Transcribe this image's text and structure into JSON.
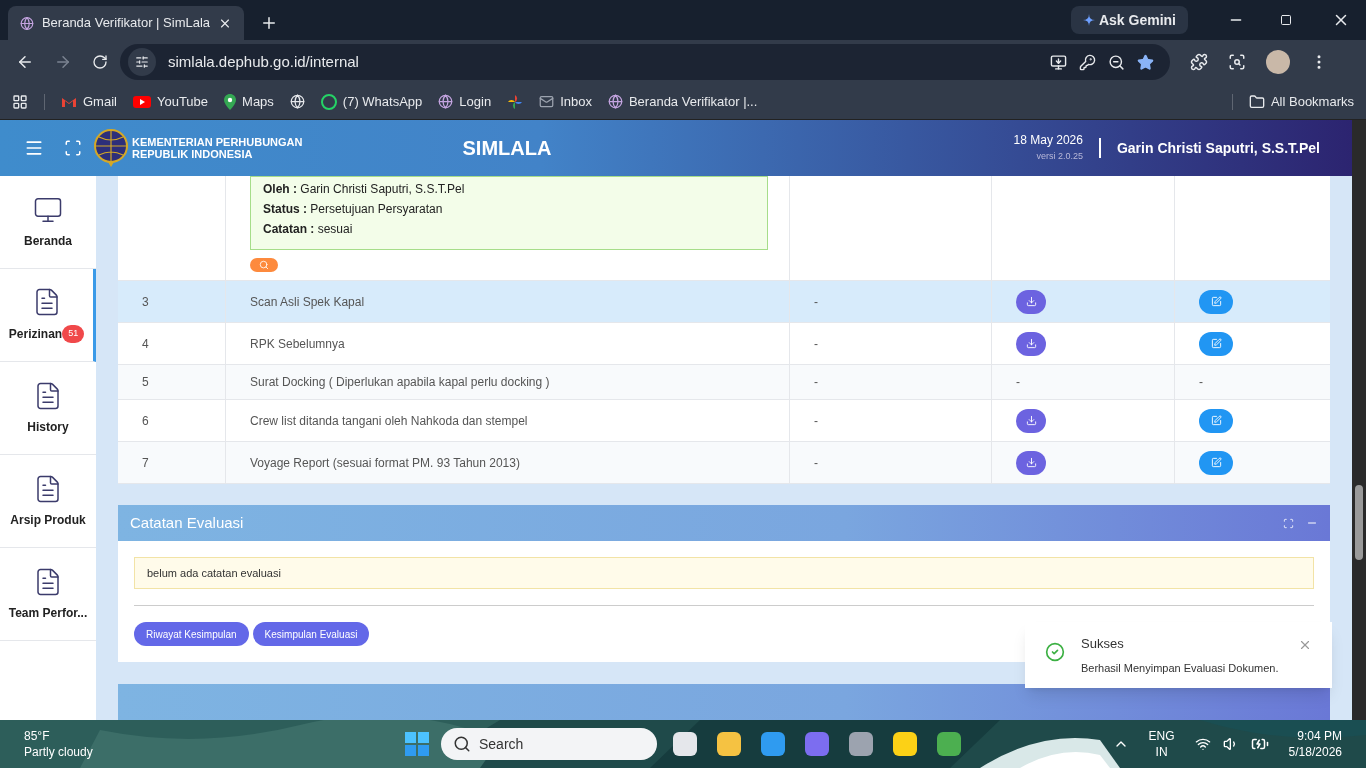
{
  "browser": {
    "tab": {
      "title": "Beranda Verifikator | SimLala"
    },
    "ask_button": "Ask Gemini",
    "address": "simlala.dephub.go.id/internal",
    "bookmarks": [
      {
        "label": "Gmail",
        "kind": "gmail"
      },
      {
        "label": "YouTube",
        "kind": "youtube"
      },
      {
        "label": "Maps",
        "kind": "maps"
      },
      {
        "kind": "globe"
      },
      {
        "label": "(7) WhatsApp",
        "kind": "whatsapp"
      },
      {
        "label": "Login",
        "kind": "site"
      },
      {
        "kind": "pinwheel"
      },
      {
        "label": "Inbox",
        "kind": "mail"
      },
      {
        "label": "Beranda Verifikator |...",
        "kind": "site"
      }
    ],
    "all_bookmarks": "All Bookmarks"
  },
  "header": {
    "org_line_1": "KEMENTERIAN PERHUBUNGAN",
    "org_line_2": "REPUBLIK INDONESIA",
    "app_title": "SIMLALA",
    "date": "18 May 2026",
    "version": "versi 2.0.25",
    "user": "Garin Christi Saputri, S.S.T.Pel"
  },
  "sidebar": {
    "items": [
      {
        "label": "Beranda",
        "kind": "home",
        "selected": false
      },
      {
        "label": "Perizinan",
        "kind": "page",
        "selected": true,
        "badge": "51"
      },
      {
        "label": "History",
        "kind": "page",
        "selected": false
      },
      {
        "label": "Arsip Produk",
        "kind": "page",
        "selected": false
      },
      {
        "label": "Team Perfor...",
        "kind": "page",
        "selected": false
      }
    ]
  },
  "table": {
    "note": [
      {
        "key": "Oleh :",
        "value": "Garin Christi Saputri, S.S.T.Pel"
      },
      {
        "key": "Status :",
        "value": "Persetujuan Persyaratan"
      },
      {
        "key": "Catatan :",
        "value": "sesuai"
      }
    ],
    "rows": [
      {
        "no": "3",
        "name": "Scan Asli Spek Kapal",
        "column_3": "-",
        "download": true,
        "edit": true,
        "selected": true
      },
      {
        "no": "4",
        "name": "RPK Sebelumnya",
        "column_3": "-",
        "download": true,
        "edit": true,
        "selected": false
      },
      {
        "no": "5",
        "name": "Surat Docking ( Diperlukan apabila kapal perlu docking )",
        "column_3": "-",
        "download": false,
        "edit": false,
        "column_4": "-",
        "column_5": "-",
        "selected": false
      },
      {
        "no": "6",
        "name": "Crew list ditanda tangani oleh Nahkoda dan stempel",
        "column_3": "-",
        "download": true,
        "edit": true,
        "selected": false
      },
      {
        "no": "7",
        "name": "Voyage Report (sesuai format PM. 93 Tahun 2013)",
        "column_3": "-",
        "download": true,
        "edit": true,
        "selected": false
      }
    ]
  },
  "evaluation": {
    "title": "Catatan Evaluasi",
    "notice": "belum ada catatan evaluasi",
    "buttons": [
      "Riwayat Kesimpulan",
      "Kesimpulan Evaluasi"
    ]
  },
  "toast": {
    "title": "Sukses",
    "message": "Berhasil Menyimpan Evaluasi Dokumen."
  },
  "taskbar": {
    "weather_temp": "85°F",
    "weather_text": "Partly cloudy",
    "search": "Search",
    "language": "ENG",
    "region": "IN",
    "time": "9:04 PM",
    "date": "5/18/2026"
  }
}
